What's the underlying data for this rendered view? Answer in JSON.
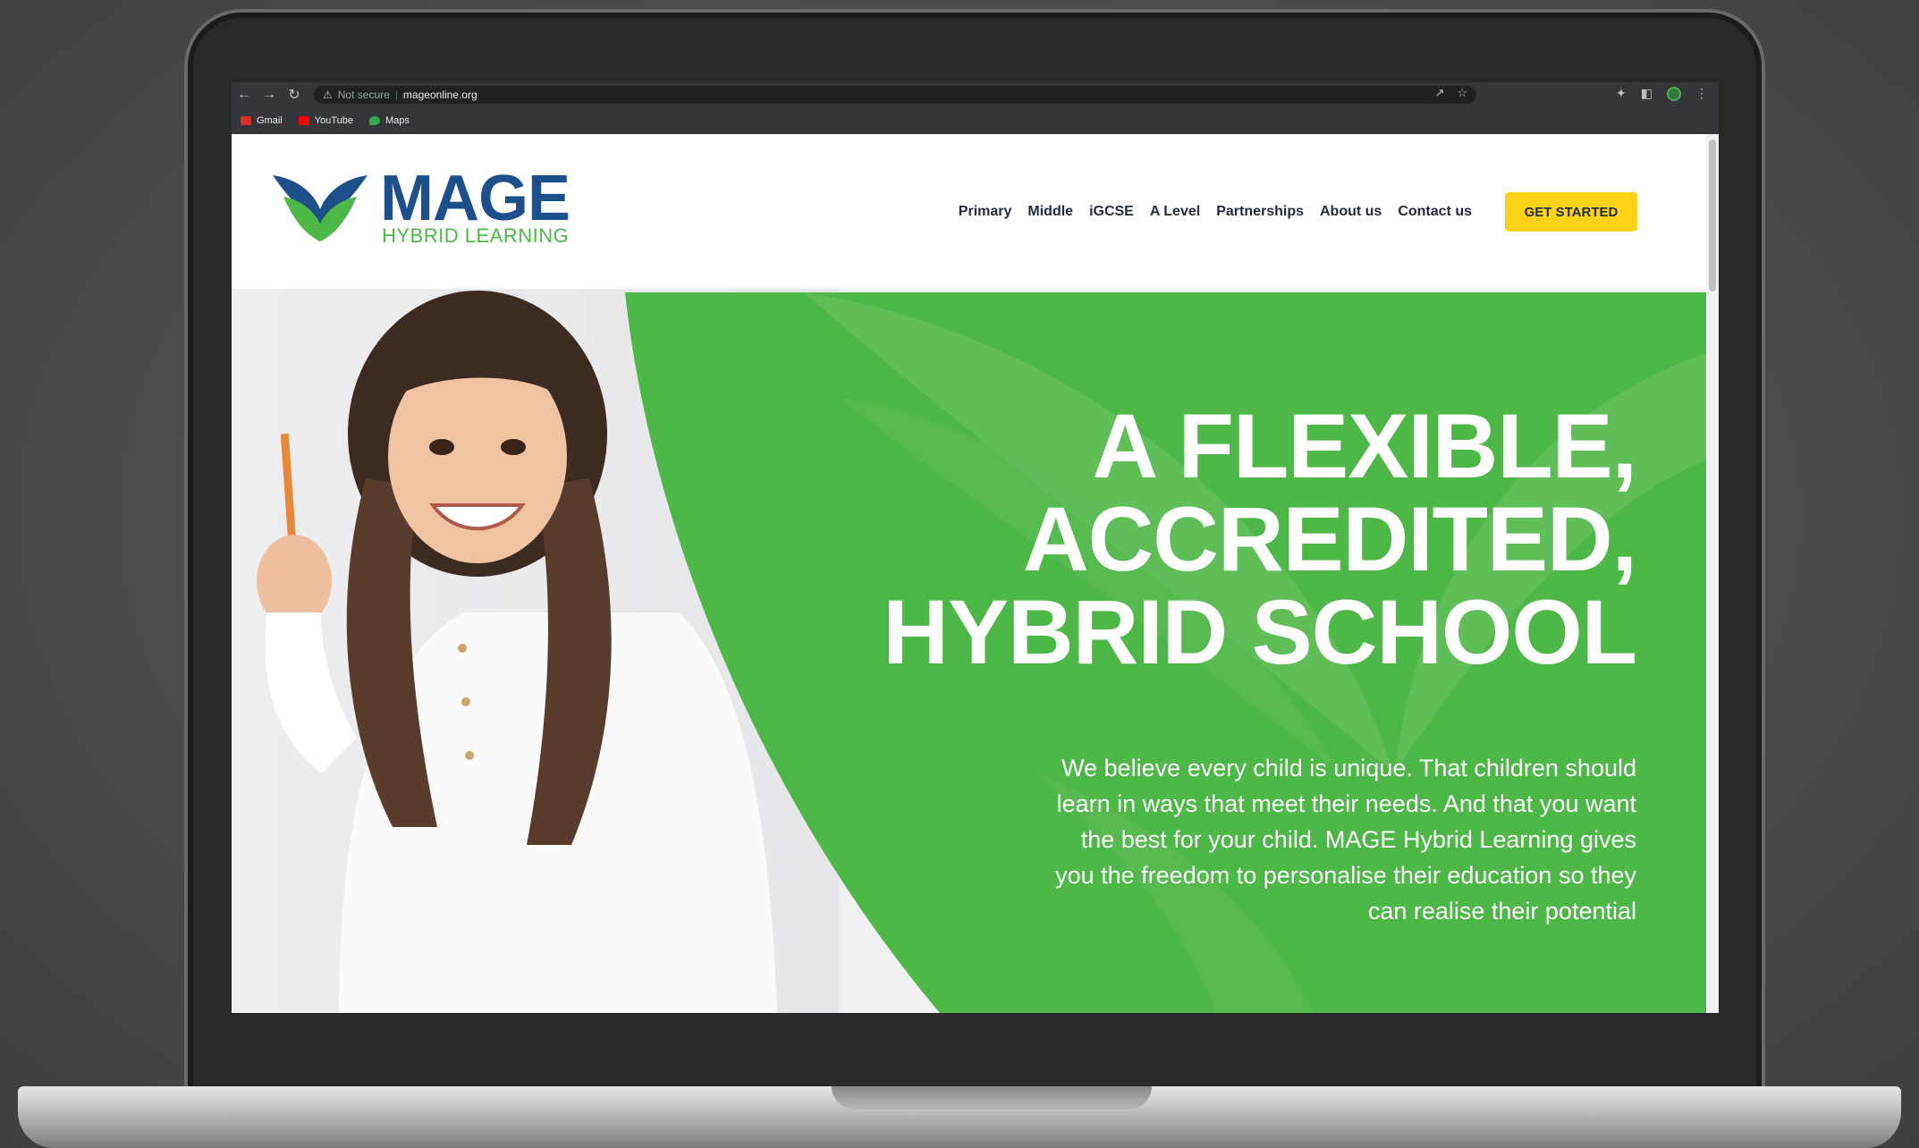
{
  "browser": {
    "security_label": "Not secure",
    "url": "mageonline.org",
    "bookmarks": [
      {
        "label": "Gmail",
        "icon": "gmail-icon",
        "color": "#d93025"
      },
      {
        "label": "YouTube",
        "icon": "youtube-icon",
        "color": "#ff0000"
      },
      {
        "label": "Maps",
        "icon": "maps-icon",
        "color": "#34a853"
      }
    ]
  },
  "site": {
    "logo_word": "MAGE",
    "logo_sub": "HYBRID LEARNING",
    "nav": [
      "Primary",
      "Middle",
      "iGCSE",
      "A Level",
      "Partnerships",
      "About us",
      "Contact us"
    ],
    "cta": "GET STARTED",
    "colors": {
      "brand_blue": "#1d4f8a",
      "brand_green": "#4db848",
      "cta_yellow": "#ffd21a"
    }
  },
  "hero": {
    "title_lines": [
      "A FLEXIBLE,",
      "ACCREDITED,",
      "HYBRID SCHOOL"
    ],
    "body_lines": [
      "We believe every child is unique. That children should",
      "learn in ways that meet their needs. And that you want",
      "the best for your child. MAGE Hybrid Learning gives",
      "you the freedom to personalise their education so they",
      "can realise their potential"
    ]
  }
}
